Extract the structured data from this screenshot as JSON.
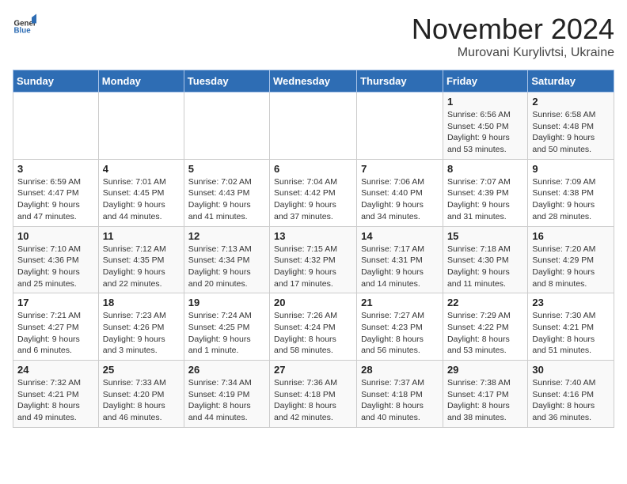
{
  "logo": {
    "text_general": "General",
    "text_blue": "Blue"
  },
  "title": "November 2024",
  "subtitle": "Murovani Kurylivtsi, Ukraine",
  "headers": [
    "Sunday",
    "Monday",
    "Tuesday",
    "Wednesday",
    "Thursday",
    "Friday",
    "Saturday"
  ],
  "weeks": [
    [
      {
        "day": "",
        "info": ""
      },
      {
        "day": "",
        "info": ""
      },
      {
        "day": "",
        "info": ""
      },
      {
        "day": "",
        "info": ""
      },
      {
        "day": "",
        "info": ""
      },
      {
        "day": "1",
        "info": "Sunrise: 6:56 AM\nSunset: 4:50 PM\nDaylight: 9 hours and 53 minutes."
      },
      {
        "day": "2",
        "info": "Sunrise: 6:58 AM\nSunset: 4:48 PM\nDaylight: 9 hours and 50 minutes."
      }
    ],
    [
      {
        "day": "3",
        "info": "Sunrise: 6:59 AM\nSunset: 4:47 PM\nDaylight: 9 hours and 47 minutes."
      },
      {
        "day": "4",
        "info": "Sunrise: 7:01 AM\nSunset: 4:45 PM\nDaylight: 9 hours and 44 minutes."
      },
      {
        "day": "5",
        "info": "Sunrise: 7:02 AM\nSunset: 4:43 PM\nDaylight: 9 hours and 41 minutes."
      },
      {
        "day": "6",
        "info": "Sunrise: 7:04 AM\nSunset: 4:42 PM\nDaylight: 9 hours and 37 minutes."
      },
      {
        "day": "7",
        "info": "Sunrise: 7:06 AM\nSunset: 4:40 PM\nDaylight: 9 hours and 34 minutes."
      },
      {
        "day": "8",
        "info": "Sunrise: 7:07 AM\nSunset: 4:39 PM\nDaylight: 9 hours and 31 minutes."
      },
      {
        "day": "9",
        "info": "Sunrise: 7:09 AM\nSunset: 4:38 PM\nDaylight: 9 hours and 28 minutes."
      }
    ],
    [
      {
        "day": "10",
        "info": "Sunrise: 7:10 AM\nSunset: 4:36 PM\nDaylight: 9 hours and 25 minutes."
      },
      {
        "day": "11",
        "info": "Sunrise: 7:12 AM\nSunset: 4:35 PM\nDaylight: 9 hours and 22 minutes."
      },
      {
        "day": "12",
        "info": "Sunrise: 7:13 AM\nSunset: 4:34 PM\nDaylight: 9 hours and 20 minutes."
      },
      {
        "day": "13",
        "info": "Sunrise: 7:15 AM\nSunset: 4:32 PM\nDaylight: 9 hours and 17 minutes."
      },
      {
        "day": "14",
        "info": "Sunrise: 7:17 AM\nSunset: 4:31 PM\nDaylight: 9 hours and 14 minutes."
      },
      {
        "day": "15",
        "info": "Sunrise: 7:18 AM\nSunset: 4:30 PM\nDaylight: 9 hours and 11 minutes."
      },
      {
        "day": "16",
        "info": "Sunrise: 7:20 AM\nSunset: 4:29 PM\nDaylight: 9 hours and 8 minutes."
      }
    ],
    [
      {
        "day": "17",
        "info": "Sunrise: 7:21 AM\nSunset: 4:27 PM\nDaylight: 9 hours and 6 minutes."
      },
      {
        "day": "18",
        "info": "Sunrise: 7:23 AM\nSunset: 4:26 PM\nDaylight: 9 hours and 3 minutes."
      },
      {
        "day": "19",
        "info": "Sunrise: 7:24 AM\nSunset: 4:25 PM\nDaylight: 9 hours and 1 minute."
      },
      {
        "day": "20",
        "info": "Sunrise: 7:26 AM\nSunset: 4:24 PM\nDaylight: 8 hours and 58 minutes."
      },
      {
        "day": "21",
        "info": "Sunrise: 7:27 AM\nSunset: 4:23 PM\nDaylight: 8 hours and 56 minutes."
      },
      {
        "day": "22",
        "info": "Sunrise: 7:29 AM\nSunset: 4:22 PM\nDaylight: 8 hours and 53 minutes."
      },
      {
        "day": "23",
        "info": "Sunrise: 7:30 AM\nSunset: 4:21 PM\nDaylight: 8 hours and 51 minutes."
      }
    ],
    [
      {
        "day": "24",
        "info": "Sunrise: 7:32 AM\nSunset: 4:21 PM\nDaylight: 8 hours and 49 minutes."
      },
      {
        "day": "25",
        "info": "Sunrise: 7:33 AM\nSunset: 4:20 PM\nDaylight: 8 hours and 46 minutes."
      },
      {
        "day": "26",
        "info": "Sunrise: 7:34 AM\nSunset: 4:19 PM\nDaylight: 8 hours and 44 minutes."
      },
      {
        "day": "27",
        "info": "Sunrise: 7:36 AM\nSunset: 4:18 PM\nDaylight: 8 hours and 42 minutes."
      },
      {
        "day": "28",
        "info": "Sunrise: 7:37 AM\nSunset: 4:18 PM\nDaylight: 8 hours and 40 minutes."
      },
      {
        "day": "29",
        "info": "Sunrise: 7:38 AM\nSunset: 4:17 PM\nDaylight: 8 hours and 38 minutes."
      },
      {
        "day": "30",
        "info": "Sunrise: 7:40 AM\nSunset: 4:16 PM\nDaylight: 8 hours and 36 minutes."
      }
    ]
  ]
}
